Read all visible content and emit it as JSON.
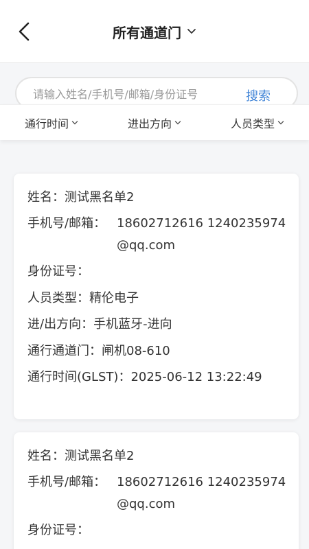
{
  "header": {
    "title": "所有通道门"
  },
  "search": {
    "placeholder": "请输入姓名/手机号/邮箱/身份证号",
    "value": "",
    "button_label": "搜索"
  },
  "filters": [
    {
      "label": "通行时间"
    },
    {
      "label": "进出方向"
    },
    {
      "label": "人员类型"
    }
  ],
  "records": [
    {
      "name_label": "姓名：",
      "name": "测试黑名单2",
      "contact_label": "手机号/邮箱：",
      "contact": "18602712616 1240235974@qq.com",
      "id_label": "身份证号：",
      "id": "",
      "type_label": "人员类型：",
      "type": "精伦电子",
      "direction_label": "进/出方向：",
      "direction": "手机蓝牙-进向",
      "gate_label": "通行通道门：",
      "gate": "闸机08-610",
      "time_label": "通行时间(GLST)：",
      "time": "2025-06-12 13:22:49"
    },
    {
      "name_label": "姓名：",
      "name": "测试黑名单2",
      "contact_label": "手机号/邮箱：",
      "contact": "18602712616 1240235974@qq.com",
      "id_label": "身份证号：",
      "id": ""
    }
  ]
}
